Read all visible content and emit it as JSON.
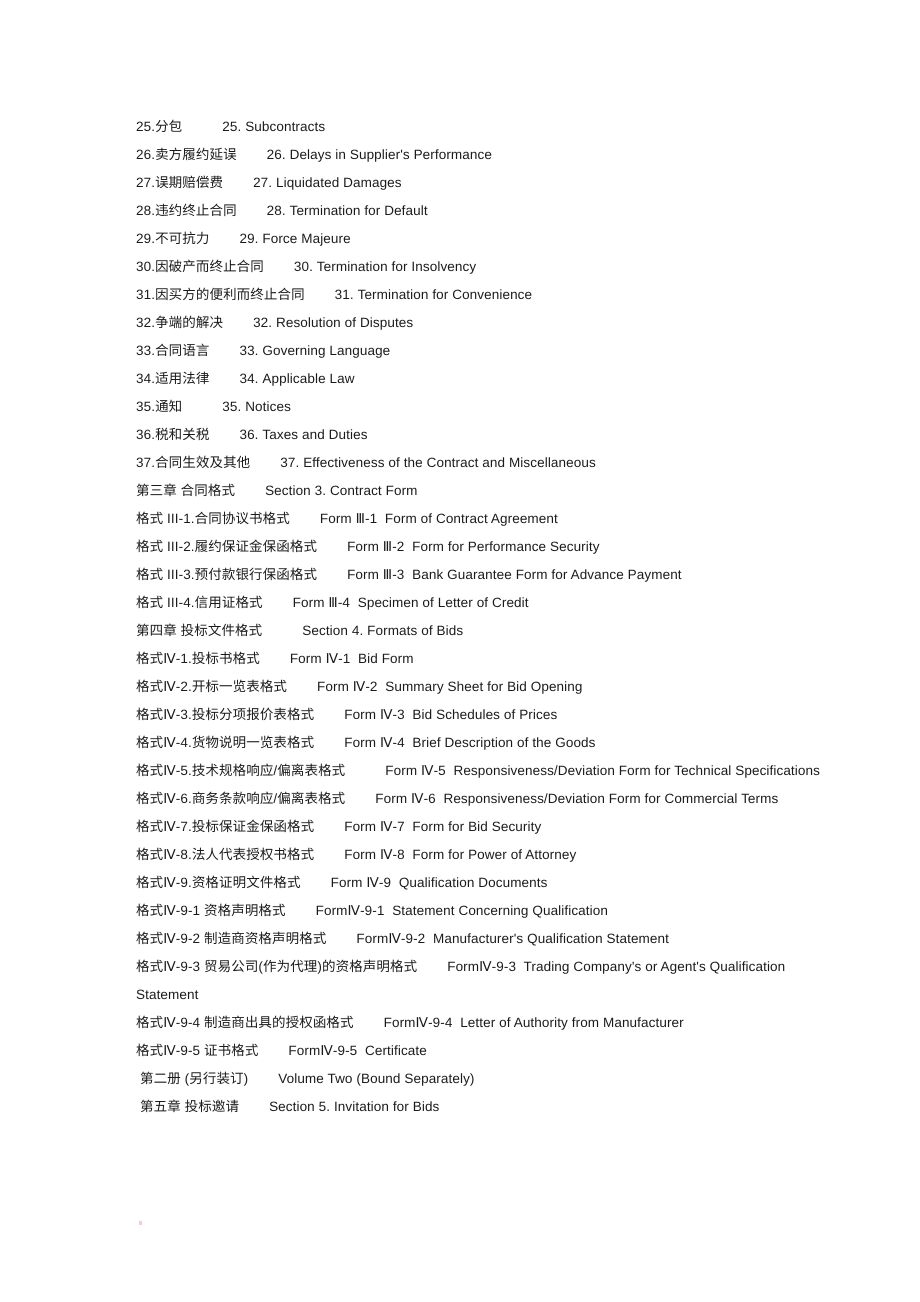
{
  "document": {
    "kind": "table-of-contents",
    "lines": [
      {
        "cn": "25.分包",
        "gap": "lg",
        "en": "25. Subcontracts"
      },
      {
        "cn": "26.卖方履约延误",
        "gap": "md",
        "en": "26. Delays in Supplier's Performance"
      },
      {
        "cn": "27.误期赔偿费",
        "gap": "md",
        "en": "27. Liquidated Damages"
      },
      {
        "cn": "28.违约终止合同",
        "gap": "md",
        "en": "28. Termination for Default"
      },
      {
        "cn": "29.不可抗力",
        "gap": "md",
        "en": "29. Force Majeure"
      },
      {
        "cn": "30.因破产而终止合同",
        "gap": "md",
        "en": "30. Termination for Insolvency"
      },
      {
        "cn": "31.因买方的便利而终止合同",
        "gap": "md",
        "en": "31. Termination for Convenience"
      },
      {
        "cn": "32.争端的解决",
        "gap": "md",
        "en": "32. Resolution of Disputes"
      },
      {
        "cn": "33.合同语言",
        "gap": "md",
        "en": "33. Governing Language"
      },
      {
        "cn": "34.适用法律",
        "gap": "md",
        "en": "34. Applicable Law"
      },
      {
        "cn": "35.通知",
        "gap": "lg",
        "en": "35. Notices"
      },
      {
        "cn": "36.税和关税",
        "gap": "md",
        "en": "36. Taxes and Duties"
      },
      {
        "cn": "37.合同生效及其他",
        "gap": "md",
        "en": "37. Effectiveness of the Contract and Miscellaneous"
      },
      {
        "cn": "第三章 合同格式",
        "gap": "md",
        "en": "Section 3. Contract Form"
      },
      {
        "cn": "格式 III-1.合同协议书格式",
        "gap": "md",
        "en": "Form Ⅲ-1  Form of Contract Agreement"
      },
      {
        "cn": "格式 III-2.履约保证金保函格式",
        "gap": "md",
        "en": "Form Ⅲ-2  Form for Performance Security"
      },
      {
        "cn": "格式 III-3.预付款银行保函格式",
        "gap": "md",
        "en": "Form Ⅲ-3  Bank Guarantee Form for Advance Payment"
      },
      {
        "cn": "格式 III-4.信用证格式",
        "gap": "md",
        "en": "Form Ⅲ-4  Specimen of Letter of Credit"
      },
      {
        "cn": "第四章 投标文件格式",
        "gap": "lg",
        "en": "Section 4. Formats of Bids"
      },
      {
        "cn": "格式Ⅳ-1.投标书格式",
        "gap": "md",
        "en": "Form Ⅳ-1  Bid Form"
      },
      {
        "cn": "格式Ⅳ-2.开标一览表格式",
        "gap": "md",
        "en": "Form Ⅳ-2  Summary Sheet for Bid Opening"
      },
      {
        "cn": "格式Ⅳ-3.投标分项报价表格式",
        "gap": "md",
        "en": "Form Ⅳ-3  Bid Schedules of Prices"
      },
      {
        "cn": "格式Ⅳ-4.货物说明一览表格式",
        "gap": "md",
        "en": "Form Ⅳ-4  Brief Description of the Goods"
      },
      {
        "cn": "格式Ⅳ-5.技术规格响应/偏离表格式",
        "gap": "lg",
        "en": "Form Ⅳ-5  Responsiveness/Deviation Form for Technical Specifications"
      },
      {
        "cn": "格式Ⅳ-6.商务条款响应/偏离表格式",
        "gap": "md",
        "en": "Form Ⅳ-6  Responsiveness/Deviation Form for Commercial Terms"
      },
      {
        "cn": "格式Ⅳ-7.投标保证金保函格式",
        "gap": "md",
        "en": "Form Ⅳ-7  Form for Bid Security"
      },
      {
        "cn": "格式Ⅳ-8.法人代表授权书格式",
        "gap": "md",
        "en": "Form Ⅳ-8  Form for Power of Attorney"
      },
      {
        "cn": "格式Ⅳ-9.资格证明文件格式",
        "gap": "md",
        "en": "Form Ⅳ-9  Qualification Documents"
      },
      {
        "cn": "格式Ⅳ-9-1 资格声明格式",
        "gap": "md",
        "en": "FormⅣ-9-1  Statement Concerning Qualification"
      },
      {
        "cn": "格式Ⅳ-9-2 制造商资格声明格式",
        "gap": "md",
        "en": "FormⅣ-9-2  Manufacturer's Qualification Statement"
      },
      {
        "cn": "格式Ⅳ-9-3 贸易公司(作为代理)的资格声明格式",
        "gap": "md",
        "en": "FormⅣ-9-3  Trading Company's or Agent's Qualification Statement"
      },
      {
        "cn": "格式Ⅳ-9-4 制造商出具的授权函格式",
        "gap": "md",
        "en": "FormⅣ-9-4  Letter of Authority from Manufacturer"
      },
      {
        "cn": "格式Ⅳ-9-5 证书格式",
        "gap": "md",
        "en": "FormⅣ-9-5  Certificate"
      },
      {
        "cn": "第二册 (另行装订)",
        "gap": "md",
        "en": "Volume Two (Bound Separately)",
        "indented": true
      },
      {
        "cn": "第五章 投标邀请",
        "gap": "md",
        "en": "Section 5. Invitation for Bids",
        "indented": true
      }
    ]
  }
}
